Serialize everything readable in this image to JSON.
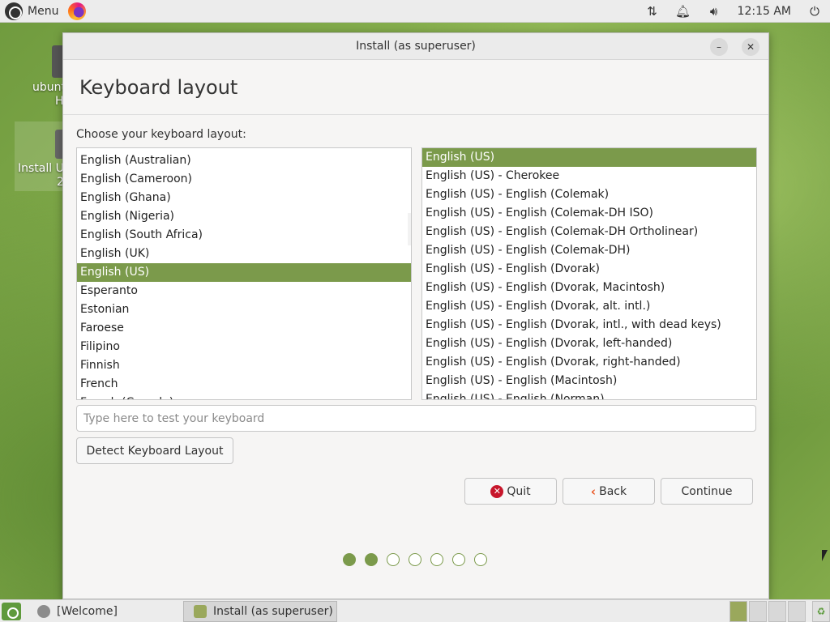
{
  "top_panel": {
    "menu_label": "Menu",
    "clock": "12:15 AM",
    "tray_icons": [
      "network-icon",
      "notification-bell-icon",
      "volume-icon",
      "power-icon"
    ]
  },
  "desktop": {
    "icons": [
      {
        "label_fragment_1": "ubunt",
        "label_fragment_2": "H"
      },
      {
        "label_fragment_1": "Install U",
        "label_fragment_2": "2"
      }
    ]
  },
  "window": {
    "title": "Install (as superuser)",
    "page_title": "Keyboard layout",
    "prompt": "Choose your keyboard layout:",
    "layouts": [
      {
        "label": "",
        "selected": false
      },
      {
        "label": "English (Australian)",
        "selected": false
      },
      {
        "label": "English (Cameroon)",
        "selected": false
      },
      {
        "label": "English (Ghana)",
        "selected": false
      },
      {
        "label": "English (Nigeria)",
        "selected": false
      },
      {
        "label": "English (South Africa)",
        "selected": false
      },
      {
        "label": "English (UK)",
        "selected": false
      },
      {
        "label": "English (US)",
        "selected": true
      },
      {
        "label": "Esperanto",
        "selected": false
      },
      {
        "label": "Estonian",
        "selected": false
      },
      {
        "label": "Faroese",
        "selected": false
      },
      {
        "label": "Filipino",
        "selected": false
      },
      {
        "label": "Finnish",
        "selected": false
      },
      {
        "label": "French",
        "selected": false
      },
      {
        "label": "French (Canada)",
        "selected": false
      }
    ],
    "variants": [
      {
        "label": "English (US)",
        "selected": true
      },
      {
        "label": "English (US) - Cherokee",
        "selected": false
      },
      {
        "label": "English (US) - English (Colemak)",
        "selected": false
      },
      {
        "label": "English (US) - English (Colemak-DH ISO)",
        "selected": false
      },
      {
        "label": "English (US) - English (Colemak-DH Ortholinear)",
        "selected": false
      },
      {
        "label": "English (US) - English (Colemak-DH)",
        "selected": false
      },
      {
        "label": "English (US) - English (Dvorak)",
        "selected": false
      },
      {
        "label": "English (US) - English (Dvorak, Macintosh)",
        "selected": false
      },
      {
        "label": "English (US) - English (Dvorak, alt. intl.)",
        "selected": false
      },
      {
        "label": "English (US) - English (Dvorak, intl., with dead keys)",
        "selected": false
      },
      {
        "label": "English (US) - English (Dvorak, left-handed)",
        "selected": false
      },
      {
        "label": "English (US) - English (Dvorak, right-handed)",
        "selected": false
      },
      {
        "label": "English (US) - English (Macintosh)",
        "selected": false
      },
      {
        "label": "English (US) - English (Norman)",
        "selected": false
      }
    ],
    "test_placeholder": "Type here to test your keyboard",
    "detect_label": "Detect Keyboard Layout",
    "quit_label": "Quit",
    "back_label": "Back",
    "continue_label": "Continue",
    "progress": {
      "total_steps": 7,
      "completed_steps": 2
    },
    "accent_color": "#7b9a4b"
  },
  "bottom_panel": {
    "tasks": [
      {
        "label": "[Welcome]",
        "active": false
      },
      {
        "label": "Install (as superuser)",
        "active": true
      }
    ]
  }
}
